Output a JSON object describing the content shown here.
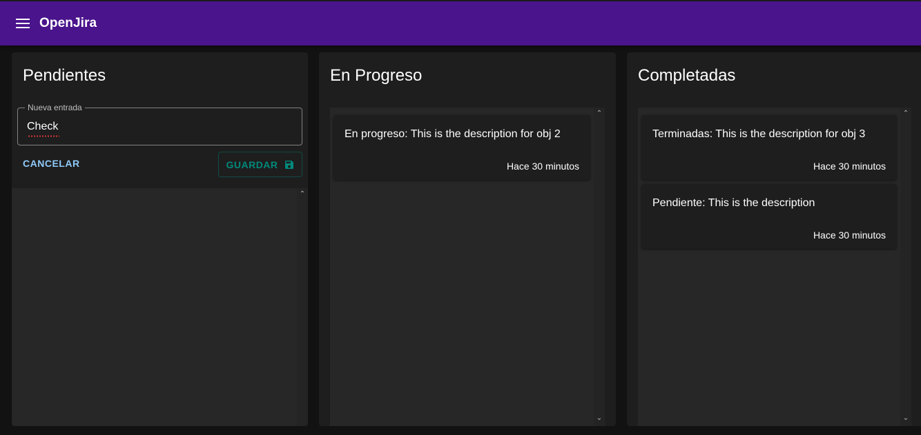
{
  "app": {
    "title": "OpenJira"
  },
  "columns": {
    "pending": {
      "title": "Pendientes",
      "new_entry": {
        "legend": "Nueva entrada",
        "value": "Check",
        "cancel_label": "CANCELAR",
        "save_label": "GUARDAR"
      },
      "entries": []
    },
    "in_progress": {
      "title": "En Progreso",
      "entries": [
        {
          "description": "En progreso: This is the description for obj 2",
          "time": "Hace 30 minutos"
        }
      ]
    },
    "finished": {
      "title": "Completadas",
      "entries": [
        {
          "description": "Terminadas: This is the description for obj 3",
          "time": "Hace 30 minutos"
        },
        {
          "description": "Pendiente: This is the description",
          "time": "Hace 30 minutos"
        }
      ]
    }
  },
  "colors": {
    "appbar": "#4a148c",
    "background": "#121212",
    "column": "#1e1e1e",
    "list": "#272727",
    "cancel": "#90caf9",
    "save": "#00897b"
  },
  "icons": {
    "menu": "menu-icon",
    "save": "save-icon",
    "scroll_up": "chevron-up-icon",
    "scroll_down": "chevron-down-icon"
  }
}
